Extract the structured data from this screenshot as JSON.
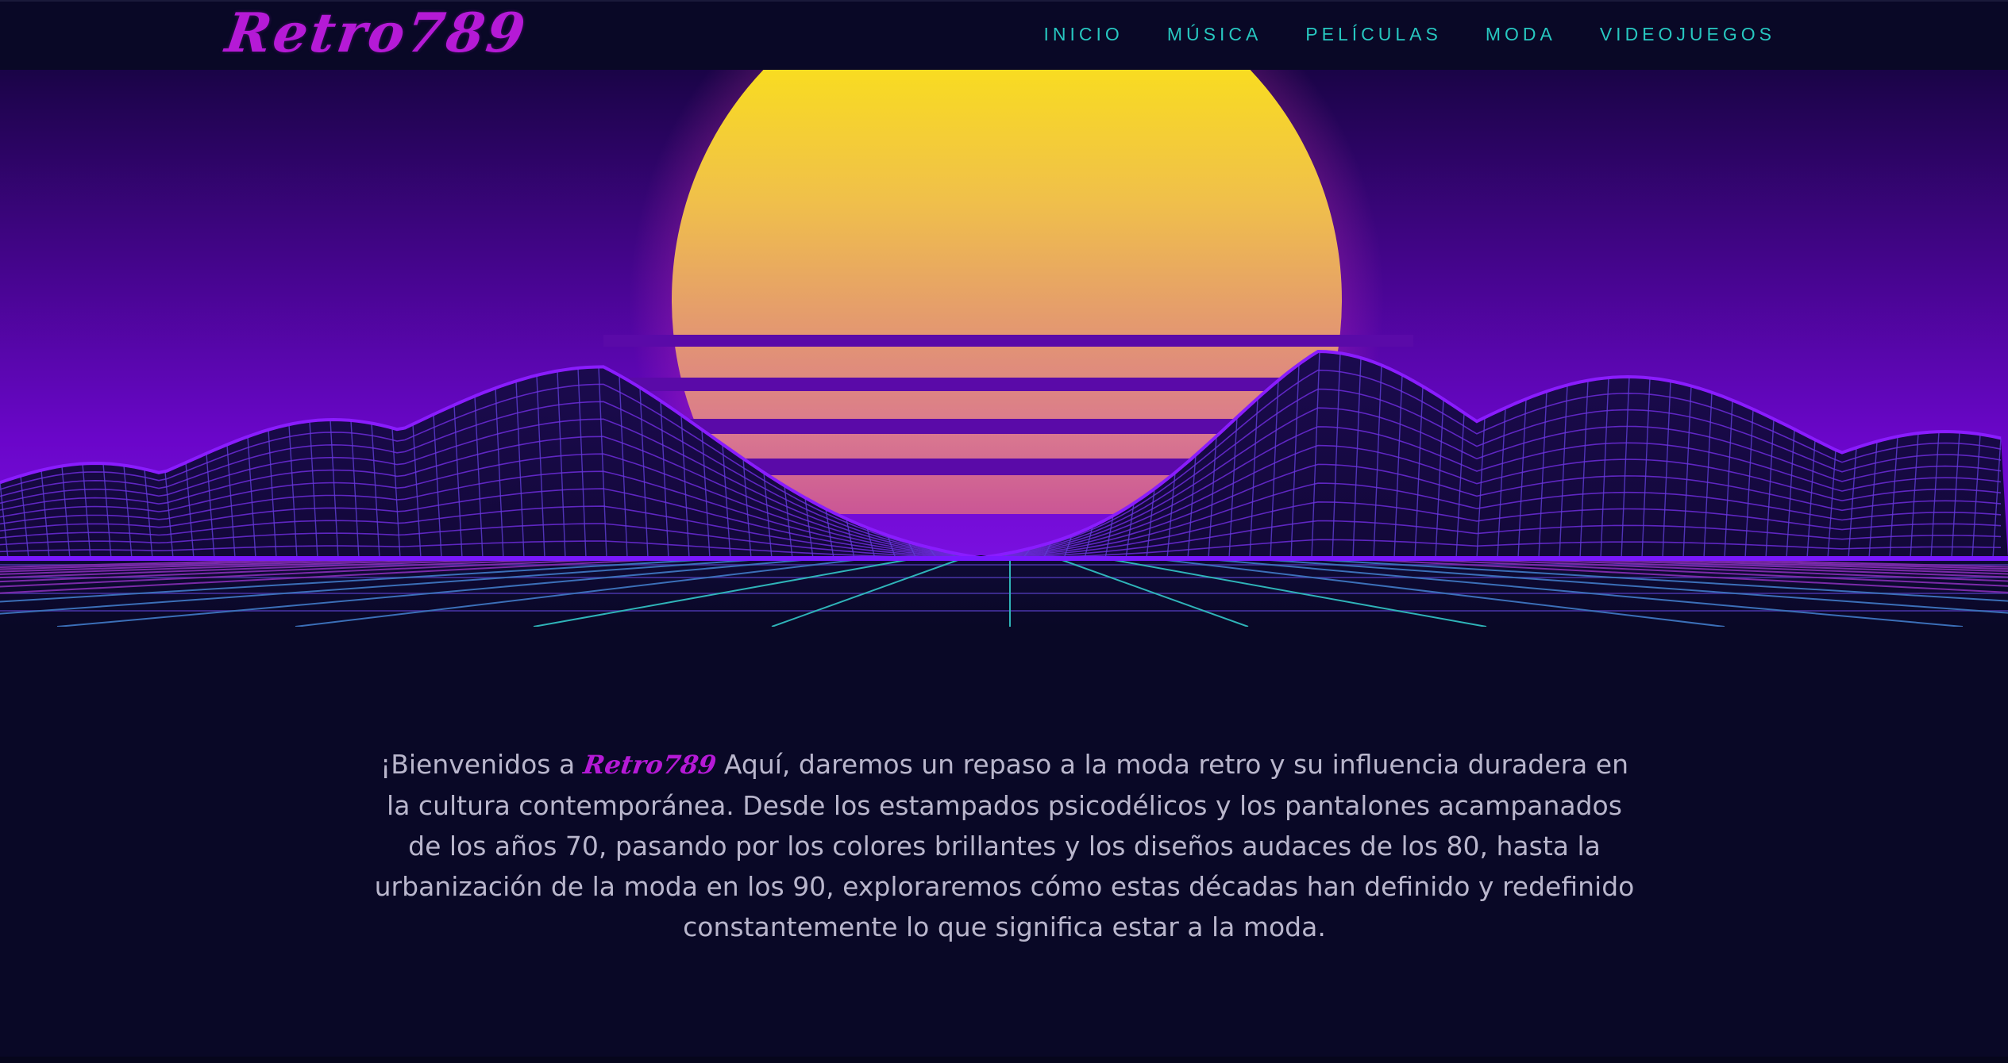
{
  "header": {
    "logo": "Retro789",
    "nav": [
      "INICIO",
      "MÚSICA",
      "PELÍCULAS",
      "MODA",
      "VIDEOJUEGOS"
    ]
  },
  "hero": {
    "illustration": "synthwave-sunset-wireframe-mountains"
  },
  "intro": {
    "lead": "¡Bienvenidos a ",
    "brand": "Retro789",
    "body": " Aquí, daremos un repaso a la moda retro y su influencia duradera en la cultura contemporánea. Desde los estampados psicodélicos y los pantalones acampanados de los años 70, pasando por los colores brillantes y los diseños audaces de los 80, hasta la urbanización de la moda en los 90, exploraremos cómo estas décadas han definido y redefinido constantemente lo que significa estar a la moda."
  },
  "colors": {
    "background": "#090826",
    "logo": "#b51ad6",
    "nav": "#27c7c0",
    "text": "#b9b6cc",
    "sun_top": "#fff200",
    "sun_bottom": "#c2399b",
    "sky_top": "#1a0447",
    "sky_bottom": "#6a06c9",
    "grid": "#2fb3b8",
    "mountain_line": "#8a1cff"
  }
}
